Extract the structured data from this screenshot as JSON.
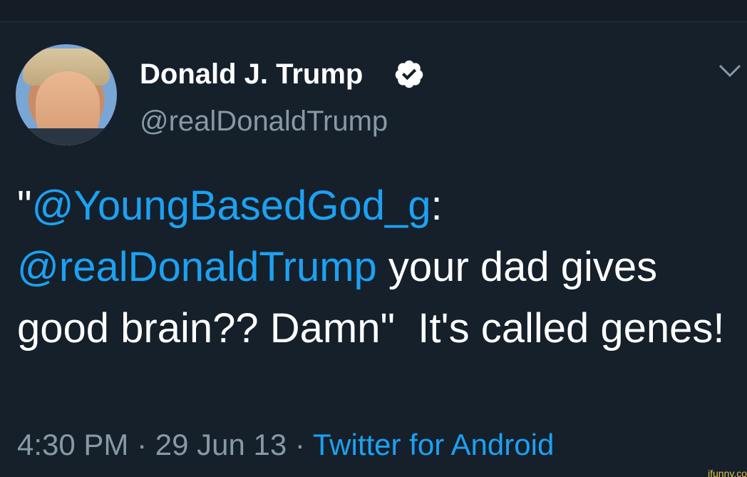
{
  "tweet": {
    "author": {
      "display_name": "Donald J. Trump",
      "handle": "@realDonaldTrump",
      "verified": true
    },
    "body": {
      "quote_open": "\"",
      "mention_1": "@YoungBasedGod_g",
      "colon": ":",
      "mention_2": "@realDonaldTrump",
      "text_1": " your dad gives good brain?? Damn\"  It's called genes!"
    },
    "meta": {
      "time": "4:30 PM",
      "sep_1": " · ",
      "date": "29 Jun 13",
      "sep_2": " · ",
      "source": "Twitter for Android"
    }
  },
  "icons": {
    "verified": "verified-badge-icon",
    "caret": "chevron-down-icon"
  },
  "colors": {
    "background": "#15202b",
    "link": "#1da1f2",
    "secondary_text": "#8899a6",
    "primary_text": "#ffffff"
  },
  "watermark": "ifunny.co"
}
